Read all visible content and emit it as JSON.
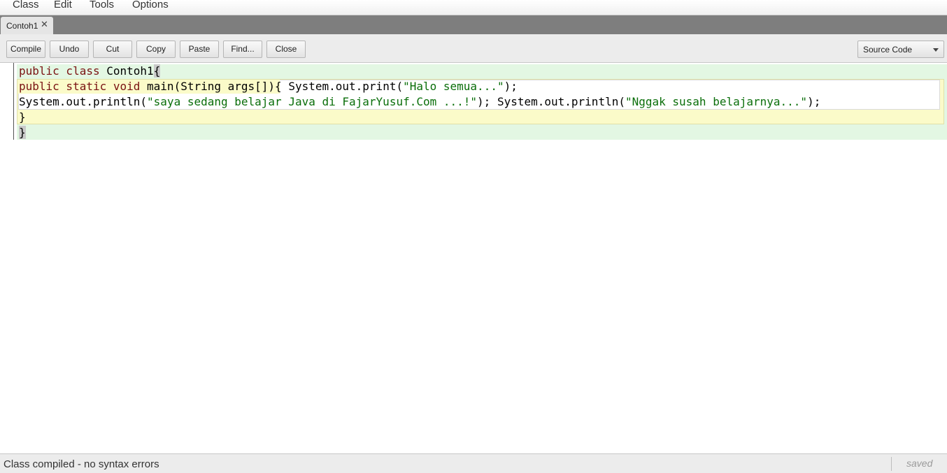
{
  "menu": {
    "items": [
      {
        "label": "Class"
      },
      {
        "label": "Edit"
      },
      {
        "label": "Tools"
      },
      {
        "label": "Options"
      }
    ]
  },
  "tabs": [
    {
      "label": "Contoh1",
      "close_icon": "close-icon"
    }
  ],
  "toolbar": {
    "buttons": [
      {
        "label": "Compile"
      },
      {
        "label": "Undo"
      },
      {
        "label": "Cut"
      },
      {
        "label": "Copy"
      },
      {
        "label": "Paste"
      },
      {
        "label": "Find..."
      },
      {
        "label": "Close"
      }
    ],
    "view_select": {
      "value": "Source Code"
    }
  },
  "editor": {
    "lines": [
      "public class Contoh1{",
      "public static void main(String args[]){ System.out.print(\"Halo semua...\");",
      "System.out.println(\"saya sedang belajar Java di FajarYusuf.Com ...!\"); System.out.println(\"Nggak susah belajarnya...\");",
      "}",
      "}"
    ],
    "tokens": {
      "l0_kw": "public class",
      "l0_name": "Contoh1",
      "l0_brace": "{",
      "l1_kw": "public static void",
      "l1_sig": "main(String args[]){",
      "l1_call": "System.out.print(",
      "l1_str": "\"Halo semua...\"",
      "l1_end": ");",
      "l2_call1": "System.out.println(",
      "l2_str1": "\"saya sedang belajar Java di FajarYusuf.Com ...!\"",
      "l2_mid": "); System.out.println(",
      "l2_str2": "\"Nggak susah belajarnya...\"",
      "l2_end": ");",
      "l3": "}",
      "l4": "}"
    }
  },
  "status": {
    "message": "Class compiled - no syntax errors",
    "saved": "saved"
  },
  "colors": {
    "keyword": "#7a1212",
    "string": "#0a6e0a",
    "class_scope": "#e3f7e3",
    "method_scope": "#fbfbc9"
  }
}
